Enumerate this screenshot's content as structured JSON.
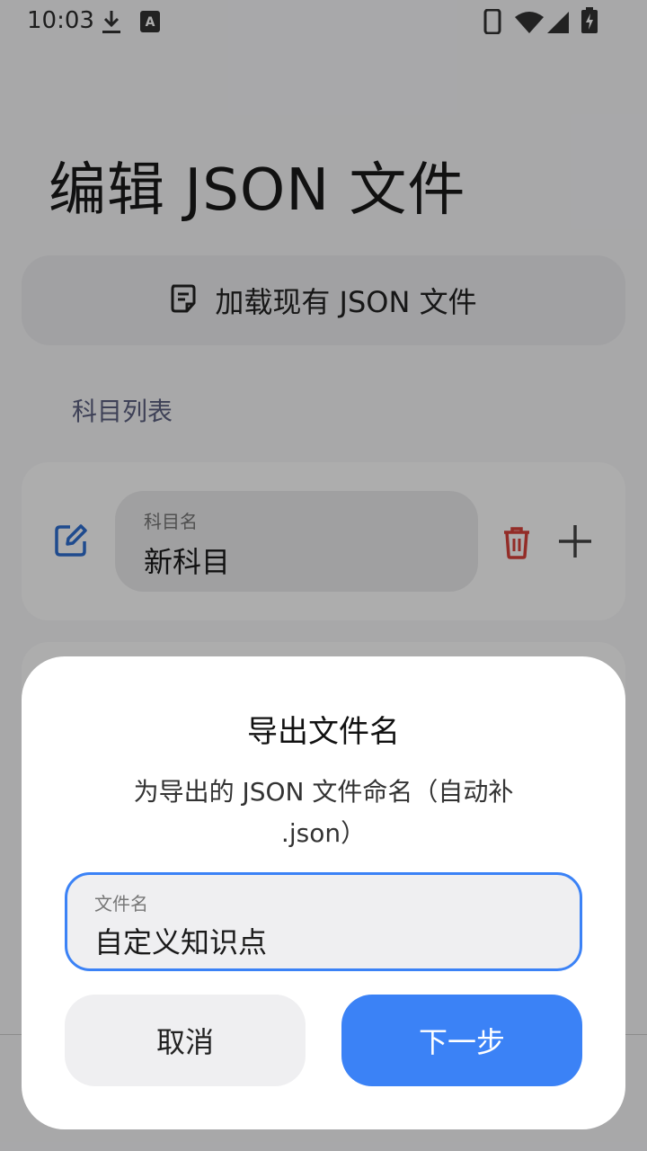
{
  "status_bar": {
    "time": "10:03",
    "icons": [
      "download-icon",
      "a-icon",
      "phone-icon",
      "wifi-icon",
      "signal-icon",
      "battery-charging-icon"
    ]
  },
  "page": {
    "title": "编辑 JSON 文件",
    "load_button_label": "加载现有 JSON 文件",
    "section_label": "科目列表",
    "subjects": [
      {
        "field_label": "科目名",
        "field_value": "新科目"
      }
    ]
  },
  "dialog": {
    "title": "导出文件名",
    "description": "为导出的 JSON 文件命名（自动补 .json）",
    "input_label": "文件名",
    "input_value": "自定义知识点",
    "cancel_label": "取消",
    "next_label": "下一步"
  },
  "colors": {
    "accent": "#3b82f6",
    "delete": "#d9413a",
    "edit": "#2f6fd1"
  }
}
